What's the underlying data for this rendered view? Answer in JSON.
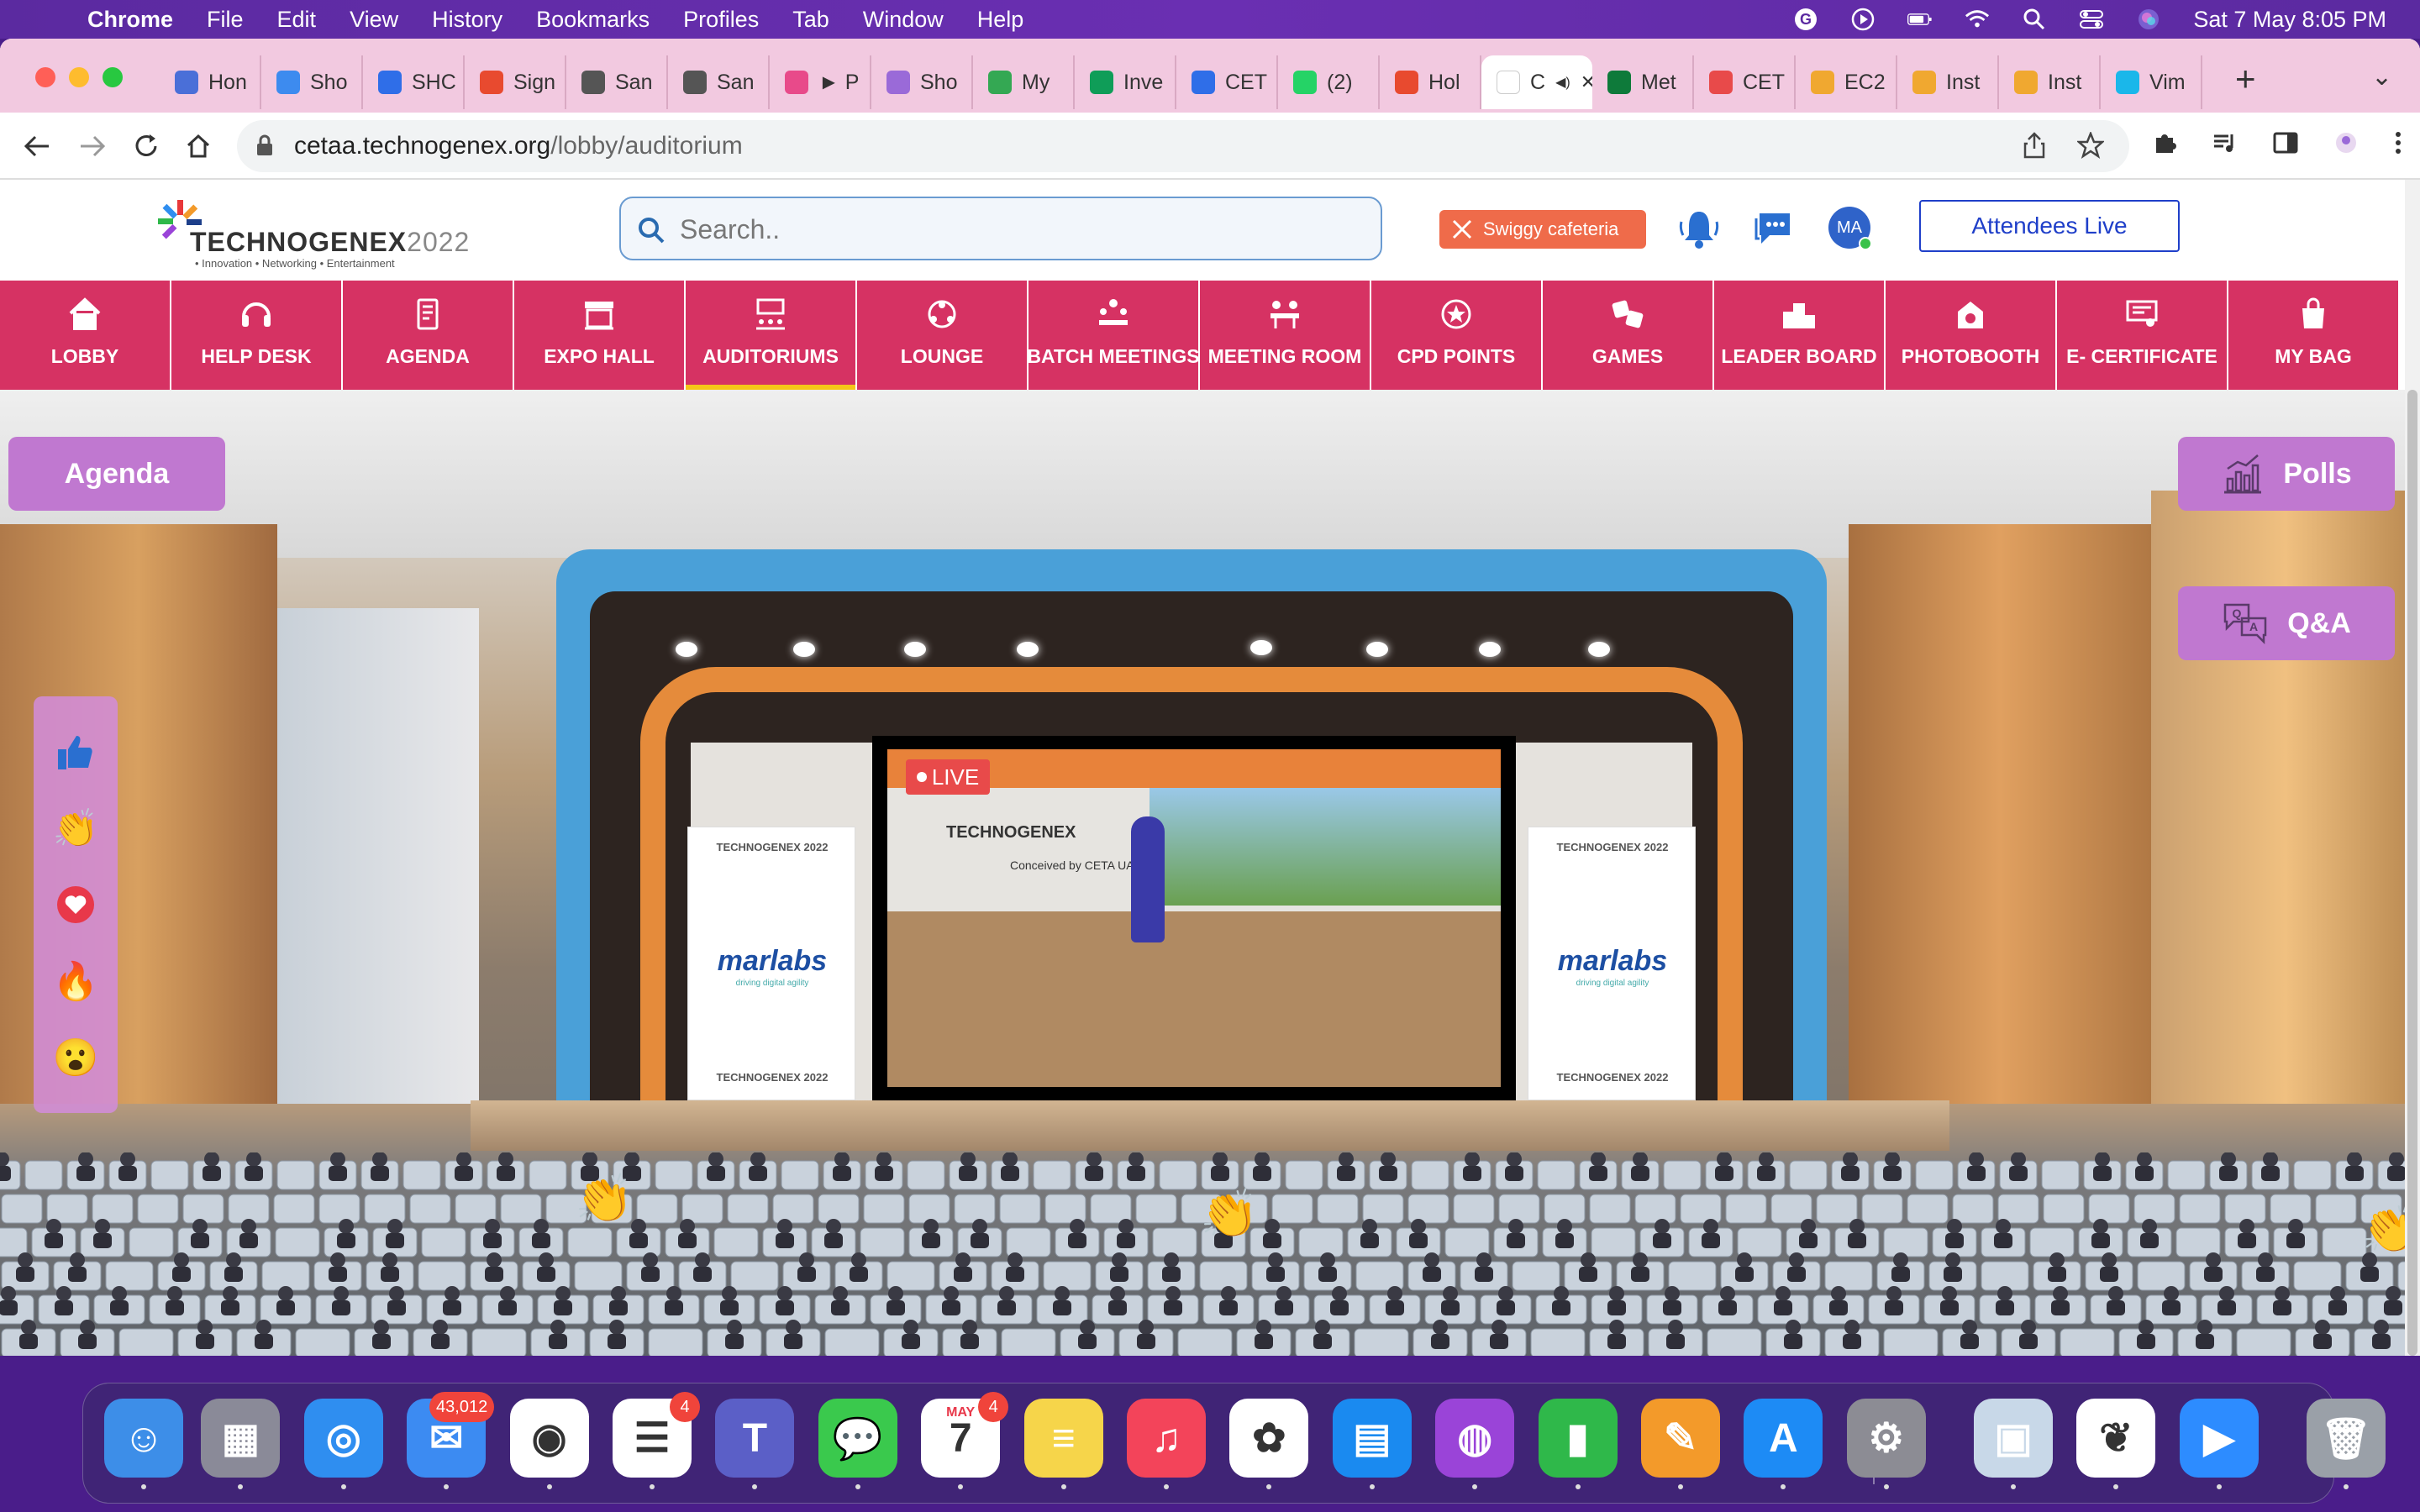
{
  "menubar": {
    "app_name": "Chrome",
    "menus": [
      "File",
      "Edit",
      "View",
      "History",
      "Bookmarks",
      "Profiles",
      "Tab",
      "Window",
      "Help"
    ],
    "datetime": "Sat 7 May  8:05 PM"
  },
  "browser": {
    "tabs": [
      {
        "label": "Hon",
        "icon": "link-icon",
        "color": "#4a6fd8"
      },
      {
        "label": "Sho",
        "icon": "check-icon",
        "color": "#3d8bef"
      },
      {
        "label": "SHC",
        "icon": "diamond-icon",
        "color": "#2f6ee8"
      },
      {
        "label": "Sign",
        "icon": "sign-icon",
        "color": "#e84a2f"
      },
      {
        "label": "San",
        "icon": "globe-icon",
        "color": "#555555"
      },
      {
        "label": "San",
        "icon": "globe-icon",
        "color": "#555555"
      },
      {
        "label": "► P",
        "icon": "figma-icon",
        "color": "#e84a8a"
      },
      {
        "label": "Sho",
        "icon": "flower-icon",
        "color": "#9a6ad8"
      },
      {
        "label": "My",
        "icon": "drive-icon",
        "color": "#34a853"
      },
      {
        "label": "Inve",
        "icon": "sheets-icon",
        "color": "#0f9d58"
      },
      {
        "label": "CET",
        "icon": "diamond-icon",
        "color": "#2f6ee8"
      },
      {
        "label": "(2)",
        "icon": "whatsapp-icon",
        "color": "#25d366"
      },
      {
        "label": "Hol",
        "icon": "arrow-icon",
        "color": "#e84a2f"
      },
      {
        "label": "C",
        "icon": "chrome-icon",
        "color": "#ffffff"
      },
      {
        "label": "Met",
        "icon": "leaf-icon",
        "color": "#0e7a3a"
      },
      {
        "label": "CET",
        "icon": "flower-icon",
        "color": "#e84a4a"
      },
      {
        "label": "EC2",
        "icon": "box-icon",
        "color": "#f0a830"
      },
      {
        "label": "Inst",
        "icon": "box-icon",
        "color": "#f0a830"
      },
      {
        "label": "Inst",
        "icon": "box-icon",
        "color": "#f0a830"
      },
      {
        "label": "Vim",
        "icon": "vimeo-icon",
        "color": "#1ab7ea"
      }
    ],
    "active_tab_index": 13,
    "url_host": "cetaa.technogenex.org",
    "url_path": "/lobby/auditorium"
  },
  "site": {
    "logo_title": "TECHNOGENEX",
    "logo_year": "2022",
    "logo_tagline": "• Innovation  • Networking  • Entertainment",
    "search_placeholder": "Search..",
    "swiggy_label": "Swiggy cafeteria",
    "avatar_initials": "MA",
    "attendees_label": "Attendees Live",
    "nav": [
      {
        "label": "LOBBY",
        "icon": "home-icon"
      },
      {
        "label": "HELP DESK",
        "icon": "headset-icon"
      },
      {
        "label": "AGENDA",
        "icon": "agenda-icon"
      },
      {
        "label": "EXPO HALL",
        "icon": "booth-icon"
      },
      {
        "label": "AUDITORIUMS",
        "icon": "auditorium-icon",
        "active": true
      },
      {
        "label": "LOUNGE",
        "icon": "lounge-icon"
      },
      {
        "label": "BATCH MEETINGS",
        "icon": "group-icon"
      },
      {
        "label": "MEETING ROOM",
        "icon": "meeting-icon"
      },
      {
        "label": "CPD POINTS",
        "icon": "badge-icon"
      },
      {
        "label": "GAMES",
        "icon": "dice-icon"
      },
      {
        "label": "LEADER BOARD",
        "icon": "podium-icon"
      },
      {
        "label": "PHOTOBOOTH",
        "icon": "camera-icon"
      },
      {
        "label": "E- CERTIFICATE",
        "icon": "certificate-icon"
      },
      {
        "label": "MY BAG",
        "icon": "bag-icon"
      }
    ],
    "agenda_button": "Agenda",
    "polls_button": "Polls",
    "qa_button": "Q&A",
    "live_label": "LIVE",
    "banner_brand": "marlabs",
    "banner_tagline": "driving digital agility",
    "banner_logo": "TECHNOGENEX 2022",
    "screen_caption": "Conceived by CETA UAE",
    "reactions": [
      "thumbs-up-icon",
      "clap-icon",
      "heart-icon",
      "fire-icon",
      "wow-icon"
    ]
  },
  "dock": [
    {
      "name": "finder",
      "color": "#3d8ee8",
      "glyph": "☺"
    },
    {
      "name": "launchpad",
      "color": "#8a8a98",
      "glyph": "▦"
    },
    {
      "name": "safari",
      "color": "#2f8ef0",
      "glyph": "◎"
    },
    {
      "name": "mail",
      "color": "#3c8bf2",
      "glyph": "✉",
      "badge": "43,012"
    },
    {
      "name": "chrome",
      "color": "#ffffff",
      "glyph": "◉"
    },
    {
      "name": "reminders",
      "color": "#ffffff",
      "glyph": "☰",
      "badge": "4"
    },
    {
      "name": "teams",
      "color": "#5b5fc7",
      "glyph": "T"
    },
    {
      "name": "messages",
      "color": "#3ac94d",
      "glyph": "💬"
    },
    {
      "name": "calendar",
      "color": "#ffffff",
      "glyph": "7",
      "badge": "4",
      "month": "MAY"
    },
    {
      "name": "notes",
      "color": "#f6d54a",
      "glyph": "≡"
    },
    {
      "name": "music",
      "color": "#f3445a",
      "glyph": "♫"
    },
    {
      "name": "photos",
      "color": "#ffffff",
      "glyph": "✿"
    },
    {
      "name": "keynote",
      "color": "#1a8af0",
      "glyph": "▤"
    },
    {
      "name": "podcasts",
      "color": "#9a44d8",
      "glyph": "◍"
    },
    {
      "name": "numbers",
      "color": "#2fb84a",
      "glyph": "▮"
    },
    {
      "name": "pages",
      "color": "#f39a2a",
      "glyph": "✎"
    },
    {
      "name": "app-store",
      "color": "#1d8bf5",
      "glyph": "A"
    },
    {
      "name": "system-preferences",
      "color": "#8c8c94",
      "glyph": "⚙"
    },
    {
      "name": "preview",
      "color": "#c8d8e8",
      "glyph": "▣"
    },
    {
      "name": "mongodb",
      "color": "#ffffff",
      "glyph": "❦"
    },
    {
      "name": "zoom",
      "color": "#2d8cff",
      "glyph": "▶"
    },
    {
      "name": "trash",
      "color": "#9aa0a8",
      "glyph": "🗑"
    }
  ]
}
